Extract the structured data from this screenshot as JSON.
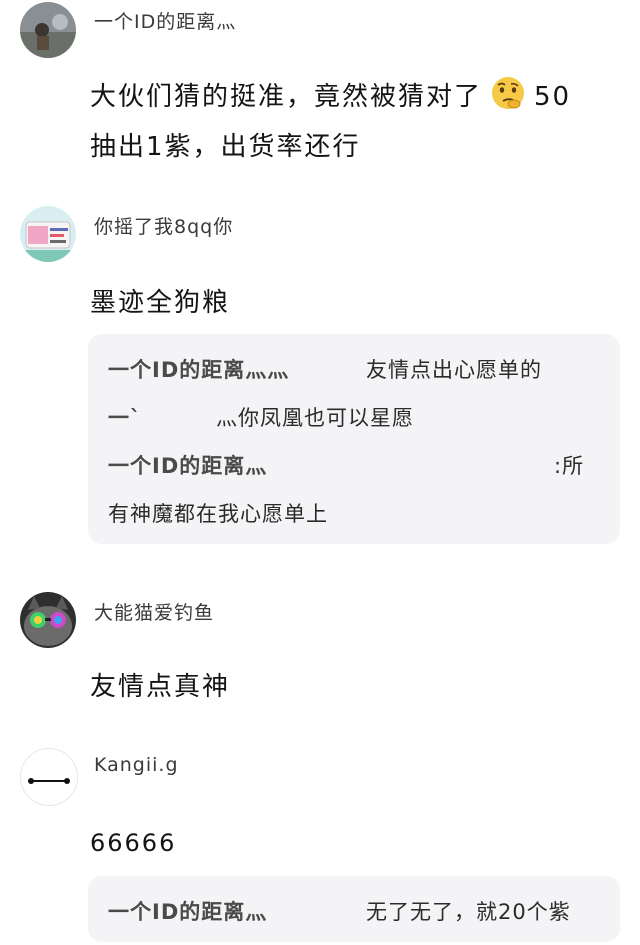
{
  "comments": [
    {
      "username": "一个ID的距离灬",
      "text_line1_before_emoji": "大伙们猜的挺准，竟然被猜对了",
      "emoji_icon": "thinking-face-emoji",
      "text_line1_after_emoji": "50",
      "text_line2": "抽出1紫，出货率还行"
    },
    {
      "username": "你摇了我8qq你",
      "text": "墨迹全狗粮",
      "replies": [
        {
          "name": "一个ID的距离灬灬",
          "text": "友情点出心愿单的"
        },
        {
          "name": "一`",
          "text": "灬你凤凰也可以星愿"
        },
        {
          "name": "一个ID的距离灬",
          "text": ":所"
        },
        {
          "name": "",
          "text": "有神魔都在我心愿单上"
        }
      ]
    },
    {
      "username": "大能猫爱钓鱼",
      "text": "友情点真神"
    },
    {
      "username": "Kangii.g",
      "text": "66666",
      "replies": [
        {
          "name": "一个ID的距离灬",
          "text": "无了无了，就20个紫"
        }
      ]
    }
  ],
  "colors": {
    "reply_background": "#f4f4f6",
    "username": "#3a3a3a",
    "text": "#141414"
  }
}
